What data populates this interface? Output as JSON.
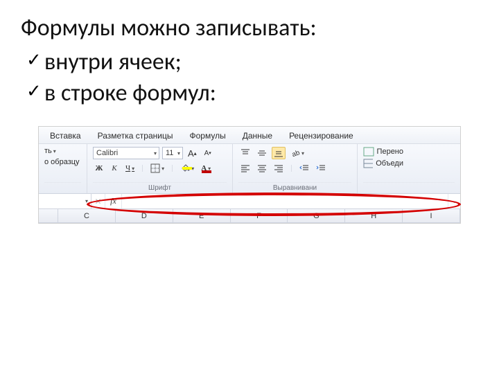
{
  "title": "Формулы можно записывать:",
  "bullets": [
    "внутри ячеек;",
    "в строке формул:"
  ],
  "checkmark": "✓",
  "excel": {
    "tabs": [
      "Вставка",
      "Разметка страницы",
      "Формулы",
      "Данные",
      "Рецензирование"
    ],
    "clipboard": {
      "paste_suffix": "ть",
      "format_painter": "о образцу"
    },
    "font": {
      "name": "Calibri",
      "size": "11",
      "bold": "Ж",
      "italic": "К",
      "underline": "Ч",
      "grow": "A",
      "shrink": "A",
      "group_label": "Шрифт"
    },
    "alignment": {
      "wrap_label": "Перено",
      "merge_label": "Объеди",
      "group_label": "Выравнивани"
    },
    "formula_bar": {
      "fx": "fx",
      "value": ""
    },
    "columns": [
      "C",
      "D",
      "E",
      "F",
      "G",
      "H",
      "I"
    ]
  }
}
